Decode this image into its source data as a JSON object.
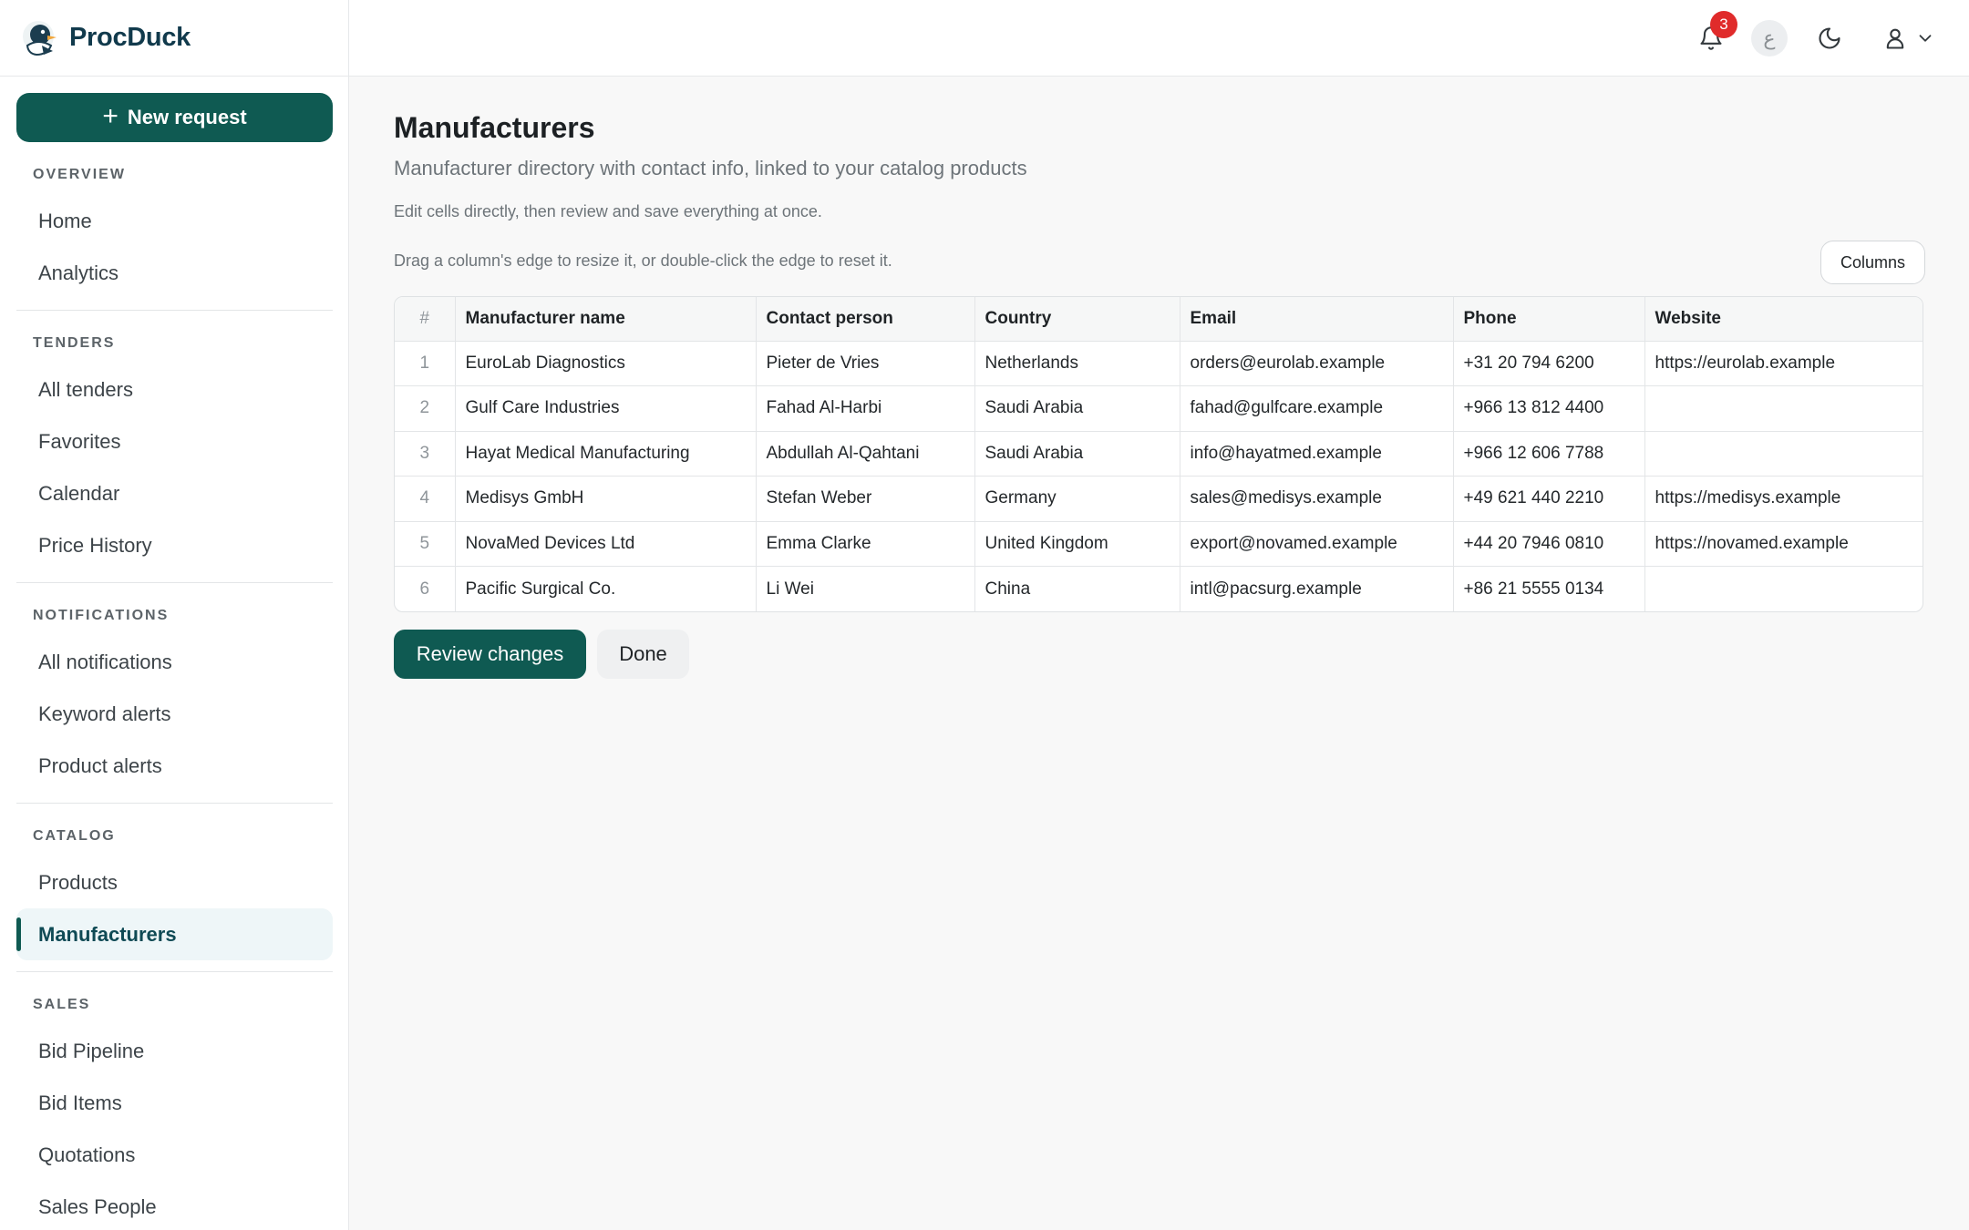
{
  "brand": {
    "name": "ProcDuck"
  },
  "sidebar": {
    "new_request_label": "New request",
    "sections": [
      {
        "title": "OVERVIEW",
        "items": [
          {
            "label": "Home"
          },
          {
            "label": "Analytics"
          }
        ]
      },
      {
        "title": "TENDERS",
        "items": [
          {
            "label": "All tenders"
          },
          {
            "label": "Favorites"
          },
          {
            "label": "Calendar"
          },
          {
            "label": "Price History"
          }
        ]
      },
      {
        "title": "NOTIFICATIONS",
        "items": [
          {
            "label": "All notifications"
          },
          {
            "label": "Keyword alerts"
          },
          {
            "label": "Product alerts"
          }
        ]
      },
      {
        "title": "CATALOG",
        "items": [
          {
            "label": "Products"
          },
          {
            "label": "Manufacturers",
            "active": true
          }
        ]
      },
      {
        "title": "SALES",
        "items": [
          {
            "label": "Bid Pipeline"
          },
          {
            "label": "Bid Items"
          },
          {
            "label": "Quotations"
          },
          {
            "label": "Sales People"
          }
        ]
      }
    ]
  },
  "topbar": {
    "notification_count": "3",
    "language_glyph": "ع",
    "icons": [
      "bell-icon",
      "moon-icon",
      "user-icon",
      "chevron-down-icon"
    ]
  },
  "main": {
    "title": "Manufacturers",
    "subtitle": "Manufacturer directory with contact info, linked to your catalog products",
    "hint_edit": "Edit cells directly, then review and save everything at once.",
    "hint_resize": "Drag a column's edge to resize it, or double-click the edge to reset it.",
    "columns_button": "Columns",
    "table": {
      "headers": [
        "#",
        "Manufacturer name",
        "Contact person",
        "Country",
        "Email",
        "Phone",
        "Website"
      ],
      "rows": [
        [
          "1",
          "EuroLab Diagnostics",
          "Pieter de Vries",
          "Netherlands",
          "orders@eurolab.example",
          "+31 20 794 6200",
          "https://eurolab.example"
        ],
        [
          "2",
          "Gulf Care Industries",
          "Fahad Al-Harbi",
          "Saudi Arabia",
          "fahad@gulfcare.example",
          "+966 13 812 4400",
          ""
        ],
        [
          "3",
          "Hayat Medical Manufacturing",
          "Abdullah Al-Qahtani",
          "Saudi Arabia",
          "info@hayatmed.example",
          "+966 12 606 7788",
          ""
        ],
        [
          "4",
          "Medisys GmbH",
          "Stefan Weber",
          "Germany",
          "sales@medisys.example",
          "+49 621 440 2210",
          "https://medisys.example"
        ],
        [
          "5",
          "NovaMed Devices Ltd",
          "Emma Clarke",
          "United Kingdom",
          "export@novamed.example",
          "+44 20 7946 0810",
          "https://novamed.example"
        ],
        [
          "6",
          "Pacific Surgical Co.",
          "Li Wei",
          "China",
          "intl@pacsurg.example",
          "+86 21 5555 0134",
          ""
        ]
      ]
    },
    "review_button": "Review changes",
    "done_button": "Done"
  },
  "colors": {
    "brand": "#0f5a52",
    "badge": "#e02b2b",
    "active_bg": "#eef6f8"
  }
}
